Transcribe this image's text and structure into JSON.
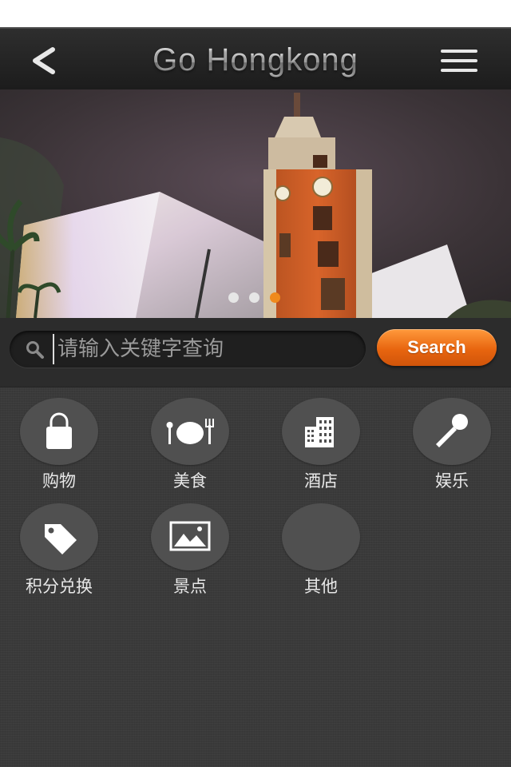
{
  "header": {
    "title": "Go Hongkong",
    "back_icon": "chevron-left-icon",
    "menu_icon": "hamburger-menu-icon"
  },
  "banner": {
    "slide_count": 3,
    "active_slide": 3
  },
  "search": {
    "placeholder": "请输入关键字查询",
    "button_label": "Search"
  },
  "categories": [
    {
      "label": "购物",
      "icon": "shopping-bag-icon"
    },
    {
      "label": "美食",
      "icon": "dining-icon"
    },
    {
      "label": "酒店",
      "icon": "hotel-building-icon"
    },
    {
      "label": "娱乐",
      "icon": "microphone-icon"
    },
    {
      "label": "积分兑换",
      "icon": "price-tag-icon"
    },
    {
      "label": "景点",
      "icon": "picture-icon"
    },
    {
      "label": "其他",
      "icon": "blank-icon"
    }
  ],
  "colors": {
    "accent": "#e8650f",
    "background": "#3a3a3a",
    "header": "#1c1c1c"
  }
}
